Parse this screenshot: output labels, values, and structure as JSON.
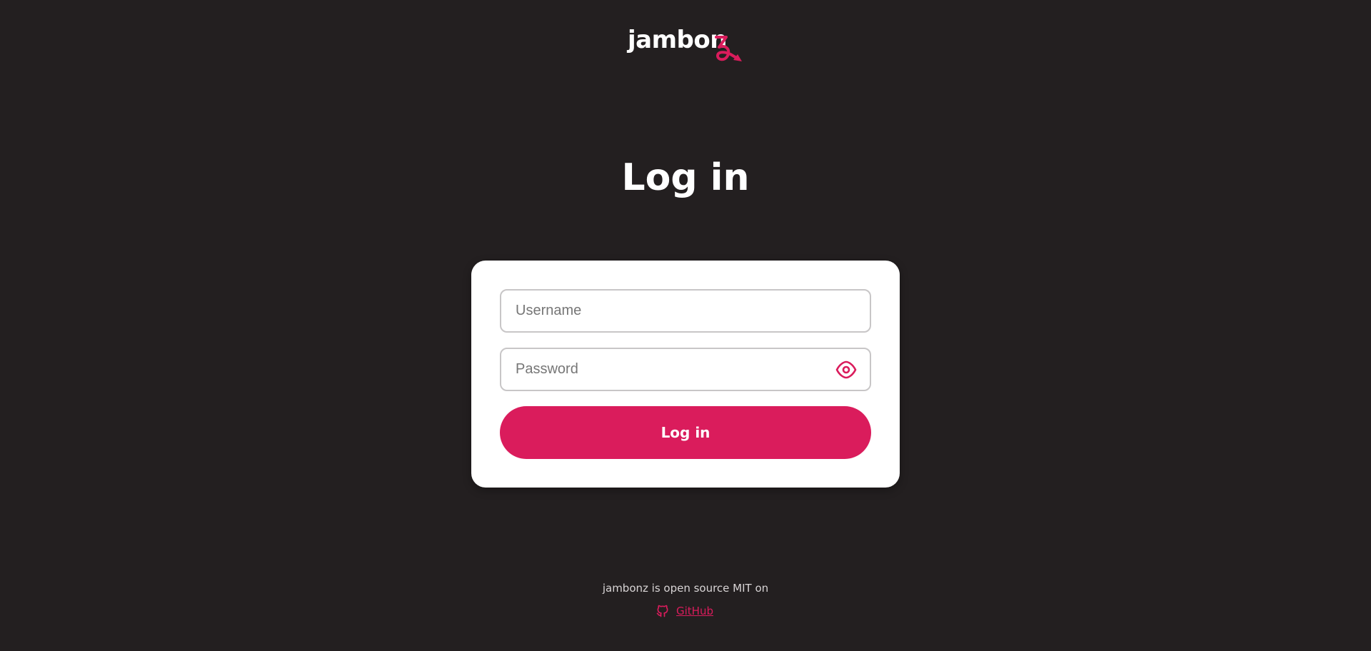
{
  "brand": {
    "logo_text": "jambon",
    "accent_color": "#da1c5c",
    "background_color": "#231f20"
  },
  "page": {
    "title": "Log in"
  },
  "form": {
    "username": {
      "value": "",
      "placeholder": "Username"
    },
    "password": {
      "value": "",
      "placeholder": "Password",
      "toggle_icon": "eye-icon"
    },
    "submit_label": "Log in"
  },
  "footer": {
    "text": "jambonz is open source MIT on",
    "link_label": "GitHub",
    "link_icon": "github-icon"
  }
}
